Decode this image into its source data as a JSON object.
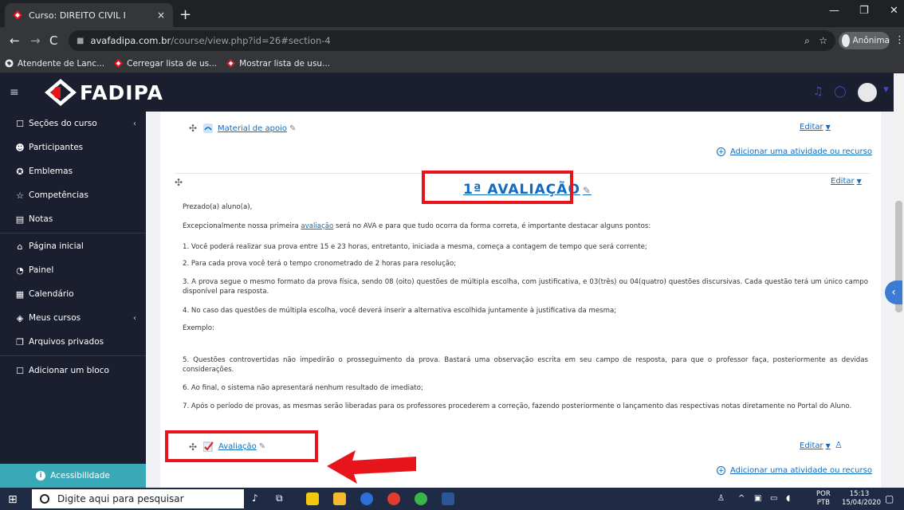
{
  "browser": {
    "tab_title": "Curso: DIREITO CIVIL I",
    "tab_close": "×",
    "new_tab": "+",
    "url_host": "avafadipa.com.br",
    "url_path": "/course/view.php?id=26#section-4",
    "incognito_label": "Anônima",
    "bookmarks": [
      "Atendente de Lanc...",
      "Cerregar lista de us...",
      "Mostrar lista de usu..."
    ]
  },
  "site": {
    "logo_text": "FADIPA"
  },
  "sidebar": {
    "items": [
      {
        "label": "Seções do curso",
        "icon": "square-icon"
      },
      {
        "label": "Participantes",
        "icon": "people-icon"
      },
      {
        "label": "Emblemas",
        "icon": "badge-icon"
      },
      {
        "label": "Competências",
        "icon": "star-icon"
      },
      {
        "label": "Notas",
        "icon": "grades-icon"
      },
      {
        "label": "Página inicial",
        "icon": "home-icon"
      },
      {
        "label": "Painel",
        "icon": "gauge-icon"
      },
      {
        "label": "Calendário",
        "icon": "calendar-icon"
      },
      {
        "label": "Meus cursos",
        "icon": "graduation-icon"
      },
      {
        "label": "Arquivos privados",
        "icon": "files-icon"
      },
      {
        "label": "Adicionar um bloco",
        "icon": "square-icon"
      }
    ],
    "accessibility": "Acessibilidade"
  },
  "content": {
    "material_link": "Material de apoio",
    "edit_label": "Editar",
    "add_activity": "Adicionar uma atividade ou recurso",
    "section_title": "1ª AVALIAÇÃO",
    "greeting": "Prezado(a) aluno(a),",
    "intro_before": "Excepcionalmente nossa primeira ",
    "intro_link": "avaliação",
    "intro_after": " será no AVA e para que tudo ocorra da forma correta, é importante destacar alguns pontos:",
    "p1": "1. Você poderá realizar sua prova entre 15 e 23 horas, entretanto, iniciada a mesma, começa a contagem de tempo que será corrente;",
    "p2": "2. Para cada prova você terá o tempo cronometrado de 2 horas para resolução;",
    "p3": "3. A prova segue o mesmo formato da prova física, sendo 08 (oito) questões de múltipla escolha, com justificativa, e 03(três) ou 04(quatro) questões discursivas. Cada questão terá um único campo disponível para resposta.",
    "p4": "4. No caso das questões de múltipla escolha, você deverá inserir a alternativa escolhida juntamente à justificativa da mesma;",
    "exemplo": "Exemplo:",
    "p5": "5. Questões controvertidas não impedirão o prosseguimento da prova. Bastará uma observação escrita em seu campo de resposta, para que o professor faça, posteriormente as devidas considerações.",
    "p6": "6. Ao final, o sistema não apresentará nenhum resultado de imediato;",
    "p7": "7. Após o período de provas, as mesmas serão liberadas para os professores procederem a correção, fazendo posteriormente o lançamento das respectivas notas diretamente no Portal do Aluno.",
    "quiz_link": "Avaliação"
  },
  "taskbar": {
    "search_placeholder": "Digite aqui para pesquisar",
    "lang_top": "POR",
    "lang_bottom": "PTB",
    "time": "15:13",
    "date": "15/04/2020"
  },
  "colors": {
    "nav_bg": "#1b1e2e",
    "link": "#0f6cbf",
    "highlight": "#e8141b",
    "accessibility": "#3aa9b7"
  }
}
